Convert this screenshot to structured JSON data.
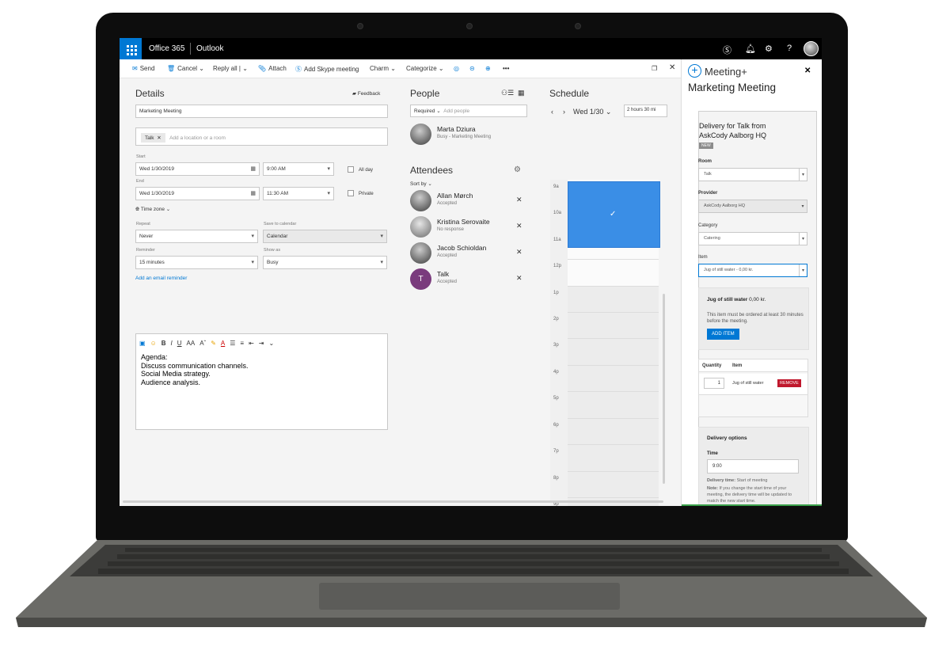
{
  "topbar": {
    "suite": "Office 365",
    "app": "Outlook"
  },
  "toolbar": {
    "send": "Send",
    "cancel": "Cancel",
    "reply_all": "Reply all",
    "attach": "Attach",
    "skype": "Add Skype meeting",
    "charm": "Charm",
    "categorize": "Categorize"
  },
  "details": {
    "heading": "Details",
    "feedback": "Feedback",
    "title_value": "Marketing Meeting",
    "location_tag": "Talk",
    "location_placeholder": "Add a location or a room",
    "start_label": "Start",
    "start_date": "Wed 1/30/2019",
    "start_time": "9:00 AM",
    "end_label": "End",
    "end_date": "Wed 1/30/2019",
    "end_time": "11:30 AM",
    "all_day": "All day",
    "private": "Private",
    "time_zone": "Time zone",
    "repeat_label": "Repeat",
    "repeat_value": "Never",
    "save_label": "Save to calendar",
    "save_value": "Calendar",
    "reminder_label": "Reminder",
    "reminder_value": "15 minutes",
    "show_label": "Show as",
    "show_value": "Busy",
    "email_reminder": "Add an email reminder",
    "body_lines": [
      "Agenda:",
      "Discuss communication channels.",
      "Social Media strategy.",
      "Audience analysis."
    ]
  },
  "people": {
    "heading": "People",
    "required": "Required",
    "add_placeholder": "Add people",
    "organizer": {
      "name": "Marta Dziura",
      "status": "Busy - Marketing Meeting"
    },
    "attendees_heading": "Attendees",
    "sort_by": "Sort by",
    "attendees": [
      {
        "name": "Allan Mørch",
        "status": "Accepted"
      },
      {
        "name": "Kristina Serovaite",
        "status": "No response"
      },
      {
        "name": "Jacob Schioldan",
        "status": "Accepted"
      },
      {
        "name": "Talk",
        "status": "Accepted",
        "initial": "T"
      }
    ]
  },
  "schedule": {
    "heading": "Schedule",
    "date": "Wed 1/30",
    "duration": "2 hours 30 mi",
    "hours": [
      "9a",
      "10a",
      "11a",
      "12p",
      "1p",
      "2p",
      "3p",
      "4p",
      "5p",
      "6p",
      "7p",
      "8p",
      "9p"
    ]
  },
  "panel": {
    "brand": "Meeting+",
    "title": "Marketing Meeting",
    "delivery_title": "Delivery for Talk from AskCody Aalborg HQ",
    "badge": "NEW",
    "room_label": "Room",
    "room_value": "Talk",
    "provider_label": "Provider",
    "provider_value": "AskCody Aalborg HQ",
    "category_label": "Category",
    "category_value": "Catering",
    "item_label": "Item",
    "item_value": "Jug of still water - 0,00 kr.",
    "item_name": "Jug of still water",
    "item_price": "0,00 kr.",
    "item_note": "This item must be ordered at least 30 minutes before the meeting.",
    "add_item": "ADD ITEM",
    "col_quantity": "Quantity",
    "col_item": "Item",
    "row_qty": "1",
    "row_item": "Jug of still water",
    "remove": "REMOVE",
    "delivery_options": "Delivery options",
    "time_label": "Time",
    "time_value": "9:00",
    "delivery_time_label": "Delivery time:",
    "delivery_time_value": "Start of meeting",
    "note_label": "Note:",
    "note_text": "If you change the start time of your meeting, the delivery time will be updated to match the new start time."
  },
  "colors": {
    "accent": "#0078d4",
    "event": "#3a8ee6",
    "remove": "#c0182d",
    "talk_avatar": "#7a3b7d"
  }
}
